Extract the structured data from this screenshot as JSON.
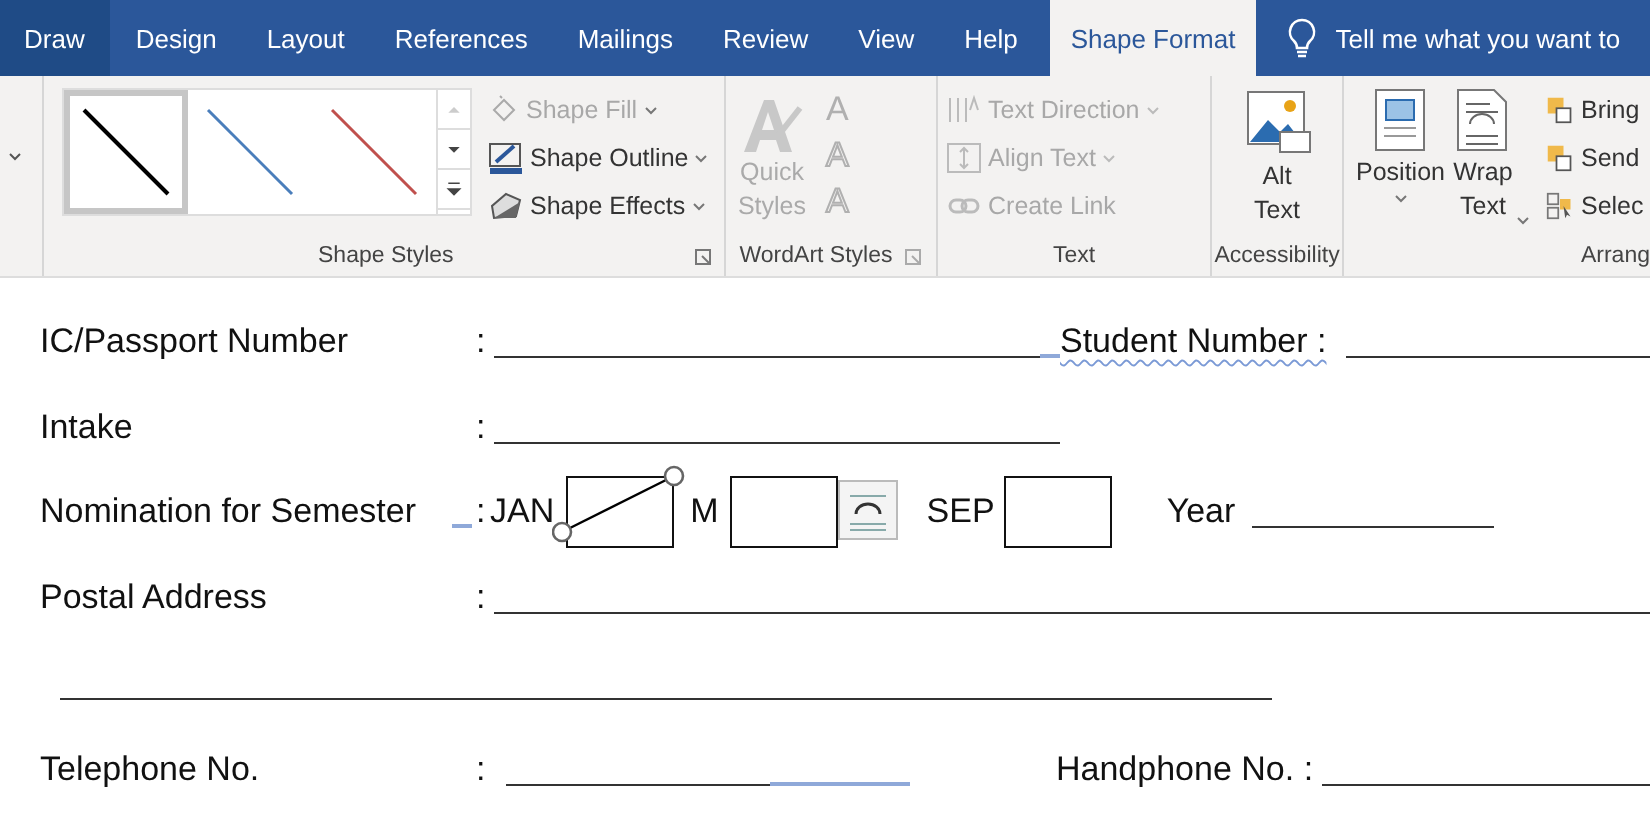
{
  "tabs": [
    {
      "label": "Draw",
      "selected": false,
      "hovered": true
    },
    {
      "label": "Design",
      "selected": false,
      "hovered": false
    },
    {
      "label": "Layout",
      "selected": false,
      "hovered": false
    },
    {
      "label": "References",
      "selected": false,
      "hovered": false
    },
    {
      "label": "Mailings",
      "selected": false,
      "hovered": false
    },
    {
      "label": "Review",
      "selected": false,
      "hovered": false
    },
    {
      "label": "View",
      "selected": false,
      "hovered": false
    },
    {
      "label": "Help",
      "selected": false,
      "hovered": false
    },
    {
      "label": "Shape Format",
      "selected": true,
      "hovered": false
    }
  ],
  "tell_me": {
    "text": "Tell me what you want to"
  },
  "shape_styles": {
    "gallery": [
      {
        "color": "#000000",
        "selected": true
      },
      {
        "color": "#4a7ebb",
        "selected": false
      },
      {
        "color": "#c0504d",
        "selected": false
      }
    ],
    "commands": [
      {
        "label": "Shape Fill",
        "disabled": true
      },
      {
        "label": "Shape Outline",
        "disabled": false
      },
      {
        "label": "Shape Effects",
        "disabled": false
      }
    ],
    "label": "Shape Styles"
  },
  "wordart_styles": {
    "quick_styles": {
      "label": "Quick Styles",
      "disabled": true
    },
    "text_buttons": [
      {
        "glyph": "A",
        "disabled": true
      },
      {
        "glyph": "A",
        "disabled": true
      },
      {
        "glyph": "A",
        "disabled": true
      }
    ],
    "label": "WordArt Styles"
  },
  "text_group": {
    "commands": [
      {
        "label": "Text Direction",
        "disabled": true
      },
      {
        "label": "Align Text",
        "disabled": true
      },
      {
        "label": "Create Link",
        "disabled": true
      }
    ],
    "label": "Text"
  },
  "accessibility": {
    "button": "Alt Text",
    "label": "Accessibility"
  },
  "arrange": {
    "big_buttons": [
      {
        "label": "Position"
      },
      {
        "label": "Wrap Text"
      }
    ],
    "commands": [
      {
        "label": "Bring"
      },
      {
        "label": "Send"
      },
      {
        "label": "Selec"
      }
    ],
    "label": "Arrang"
  },
  "form": {
    "ic": {
      "label": "IC/Passport Number",
      "colon": ":",
      "student_label": "Student Number :"
    },
    "intake": {
      "label": "Intake",
      "colon": ":"
    },
    "semester": {
      "label": "Nomination for Semester",
      "colon": ":",
      "options": [
        {
          "label": "JAN",
          "selected": true
        },
        {
          "label": "M",
          "selected": false
        },
        {
          "label": "SEP",
          "selected": false
        }
      ],
      "year_label": "Year"
    },
    "postal": {
      "label": "Postal Address",
      "colon": ":"
    },
    "telephone": {
      "label": "Telephone No.",
      "colon": ":",
      "handphone_label": "Handphone No. :"
    }
  }
}
